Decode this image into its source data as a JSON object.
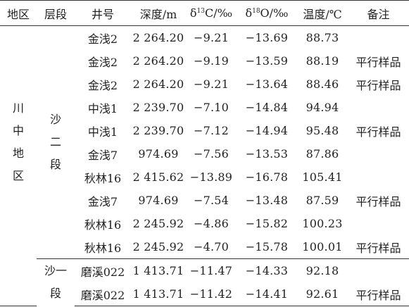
{
  "headers": {
    "region": "地区",
    "formation": "层段",
    "well": "井号",
    "depth": "深度/m",
    "c13_prefix": "δ",
    "c13_sup": "13",
    "c13_suffix": "C/‰",
    "o18_prefix": "δ",
    "o18_sup": "18",
    "o18_suffix": "O/‰",
    "temperature": "温度/℃",
    "note": "备注"
  },
  "region_chars": [
    "川",
    "中",
    "地",
    "区"
  ],
  "formation_groups": [
    {
      "chars": [
        "沙",
        "二",
        "段"
      ]
    },
    {
      "chars": [
        "沙一",
        "段"
      ]
    }
  ],
  "rows": [
    {
      "well": "金浅2",
      "depth": "2 264.20",
      "c13": "−9.21",
      "o18": "−13.69",
      "temp": "88.73",
      "note": ""
    },
    {
      "well": "金浅2",
      "depth": "2 264.20",
      "c13": "−9.19",
      "o18": "−13.59",
      "temp": "88.19",
      "note": "平行样品"
    },
    {
      "well": "金浅2",
      "depth": "2 264.20",
      "c13": "−9.21",
      "o18": "−13.64",
      "temp": "88.46",
      "note": "平行样品"
    },
    {
      "well": "中浅1",
      "depth": "2 239.70",
      "c13": "−7.10",
      "o18": "−14.84",
      "temp": "94.94",
      "note": ""
    },
    {
      "well": "中浅1",
      "depth": "2 239.70",
      "c13": "−7.12",
      "o18": "−14.94",
      "temp": "95.48",
      "note": "平行样品"
    },
    {
      "well": "金浅7",
      "depth": "974.69",
      "c13": "−7.56",
      "o18": "−13.53",
      "temp": "87.86",
      "note": ""
    },
    {
      "well": "秋林16",
      "depth": "2 415.62",
      "c13": "−13.89",
      "o18": "−16.78",
      "temp": "105.41",
      "note": ""
    },
    {
      "well": "金浅7",
      "depth": "974.69",
      "c13": "−7.54",
      "o18": "−13.48",
      "temp": "87.59",
      "note": "平行样品"
    },
    {
      "well": "秋林16",
      "depth": "2 245.92",
      "c13": "−4.86",
      "o18": "−15.82",
      "temp": "100.23",
      "note": ""
    },
    {
      "well": "秋林16",
      "depth": "2 245.92",
      "c13": "−4.70",
      "o18": "−15.78",
      "temp": "100.01",
      "note": "平行样品"
    },
    {
      "well": "磨溪022",
      "depth": "1 413.71",
      "c13": "−11.47",
      "o18": "−14.33",
      "temp": "92.18",
      "note": ""
    },
    {
      "well": "磨溪022",
      "depth": "1 413.71",
      "c13": "−11.42",
      "o18": "−14.41",
      "temp": "92.61",
      "note": "平行样品"
    }
  ]
}
